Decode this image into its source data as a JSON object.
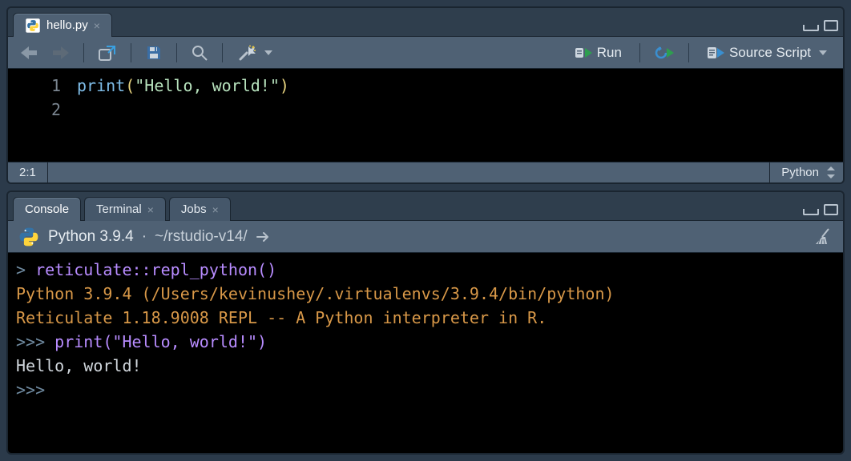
{
  "editor": {
    "tab": {
      "filename": "hello.py"
    },
    "toolbar": {
      "run_label": "Run",
      "source_label": "Source Script"
    },
    "gutter": [
      "1",
      "2"
    ],
    "code_tokens": {
      "fn": "print",
      "open": "(",
      "str": "\"Hello, world!\"",
      "close": ")"
    },
    "status": {
      "pos": "2:1",
      "language": "Python"
    }
  },
  "console": {
    "tabs": {
      "console": "Console",
      "terminal": "Terminal",
      "jobs": "Jobs"
    },
    "info": {
      "version": "Python 3.9.4",
      "sep": "·",
      "path": "~/rstudio-v14/"
    },
    "lines": {
      "l1_prompt": "> ",
      "l1_cmd": "reticulate::repl_python()",
      "l2": "Python 3.9.4 (/Users/kevinushey/.virtualenvs/3.9.4/bin/python)",
      "l3": "Reticulate 1.18.9008 REPL -- A Python interpreter in R.",
      "l4_prompt": ">>> ",
      "l4_cmd": "print(\"Hello, world!\")",
      "l5": "Hello, world!",
      "l6_prompt": ">>> "
    }
  }
}
